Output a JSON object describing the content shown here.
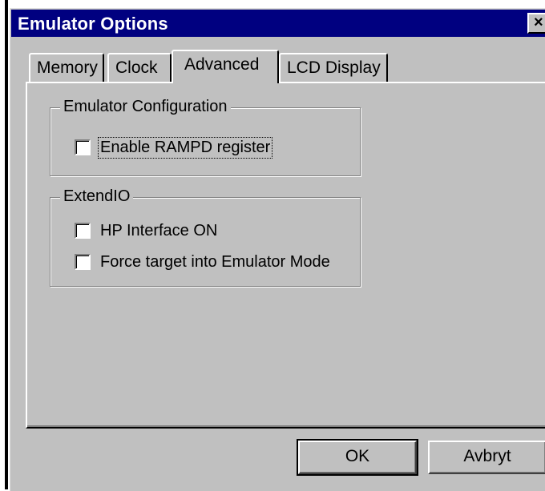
{
  "window": {
    "title": "Emulator Options",
    "close_glyph": "×"
  },
  "tabs": [
    {
      "label": "Memory",
      "active": false
    },
    {
      "label": "Clock",
      "active": false
    },
    {
      "label": "Advanced",
      "active": true
    },
    {
      "label": "LCD Display",
      "active": false
    }
  ],
  "groups": {
    "emulator_config": {
      "label": "Emulator Configuration",
      "checkboxes": [
        {
          "label": "Enable RAMPD register",
          "checked": false
        }
      ]
    },
    "extendio": {
      "label": "ExtendIO",
      "checkboxes": [
        {
          "label": "HP Interface ON",
          "checked": false
        },
        {
          "label": "Force target into Emulator Mode",
          "checked": false
        }
      ]
    }
  },
  "buttons": {
    "ok": "OK",
    "cancel": "Avbryt"
  },
  "colors": {
    "titlebar": "#000080",
    "face": "#c0c0c0"
  }
}
